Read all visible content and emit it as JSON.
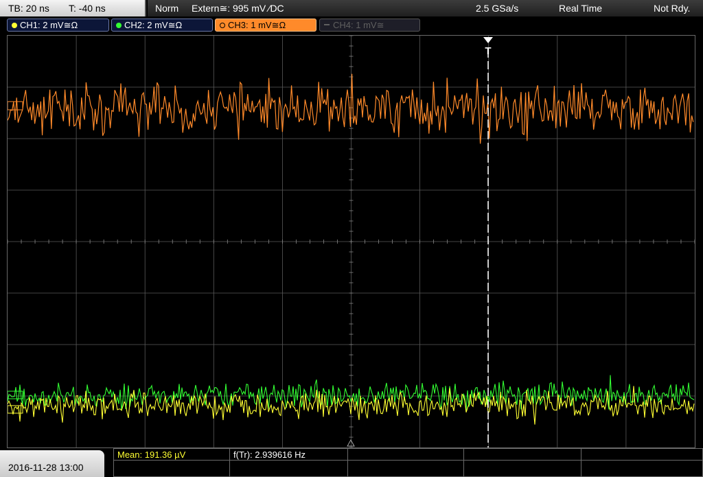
{
  "topbar": {
    "timebase": "TB: 20 ns",
    "trigger_time": "T: -40 ns",
    "mode": "Norm",
    "trigger_source": "Extern≅: 995 mV ⁄DC",
    "sample_rate": "2.5 GSa/s",
    "acquisition": "Real Time",
    "status": "Not Rdy."
  },
  "channels": [
    {
      "label": "CH1: 2 mV≅Ω",
      "color": "#ffff33",
      "active": true
    },
    {
      "label": "CH2: 2 mV≅Ω",
      "color": "#33ff33",
      "active": true
    },
    {
      "label": "CH3: 1 mV≅Ω",
      "color": "#ff8a2a",
      "active": true,
      "selected": true
    },
    {
      "label": "CH4: 1 mV≅",
      "color": "#5f5f5f",
      "active": false
    }
  ],
  "markers": {
    "trigger_marker": "T"
  },
  "measurements": {
    "mean": "Mean: 191.36 µV",
    "frequency": "f(Tr): 2.939616 Hz"
  },
  "datetime": "2016-11-28 13:00",
  "colors": {
    "grid": "#5a5a5a",
    "ch1": "#ffff33",
    "ch2": "#33ff33",
    "ch3": "#ff8a2a"
  }
}
